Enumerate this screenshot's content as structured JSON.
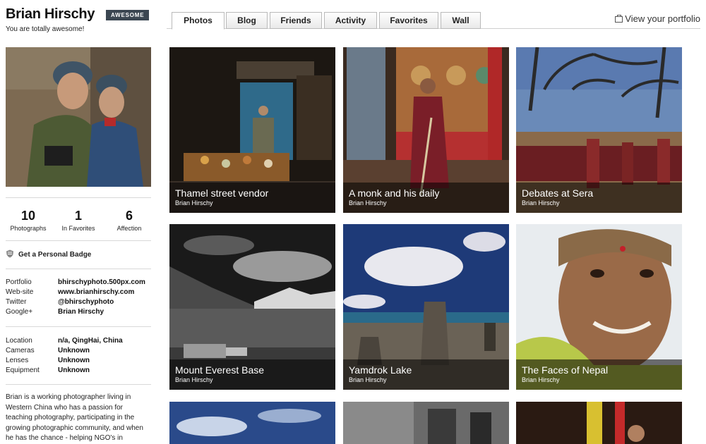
{
  "profile": {
    "name": "Brian Hirschy",
    "badge": "AWESOME",
    "tagline": "You are totally awesome!"
  },
  "tabs": [
    "Photos",
    "Blog",
    "Friends",
    "Activity",
    "Favorites",
    "Wall"
  ],
  "active_tab": "Photos",
  "portfolio_link": "View your portfolio",
  "stats": [
    {
      "value": "10",
      "label": "Photographs"
    },
    {
      "value": "1",
      "label": "In Favorites"
    },
    {
      "value": "6",
      "label": "Affection"
    }
  ],
  "badge_link": "Get a Personal Badge",
  "links": [
    {
      "key": "Portfolio",
      "value": "bhirschyphoto.500px.com"
    },
    {
      "key": "Web-site",
      "value": "www.brianhirschy.com"
    },
    {
      "key": "Twitter",
      "value": "@bhirschyphoto"
    },
    {
      "key": "Google+",
      "value": "Brian Hirschy"
    }
  ],
  "details": [
    {
      "key": "Location",
      "value": "n/a, QingHai, China"
    },
    {
      "key": "Cameras",
      "value": "Unknown"
    },
    {
      "key": "Lenses",
      "value": "Unknown"
    },
    {
      "key": "Equipment",
      "value": "Unknown"
    }
  ],
  "bio": "Brian is a working photographer living in Western China who has a passion for teaching photography, participating in the growing photographic community, and when he has the chance - helping NGO's in",
  "photos": [
    {
      "title": "Thamel street vendor",
      "author": "Brian Hirschy"
    },
    {
      "title": "A monk and his daily",
      "author": "Brian Hirschy"
    },
    {
      "title": "Debates at Sera",
      "author": "Brian Hirschy"
    },
    {
      "title": "Mount Everest Base",
      "author": "Brian Hirschy"
    },
    {
      "title": "Yamdrok Lake",
      "author": "Brian Hirschy"
    },
    {
      "title": "The Faces of Nepal",
      "author": "Brian Hirschy"
    }
  ]
}
